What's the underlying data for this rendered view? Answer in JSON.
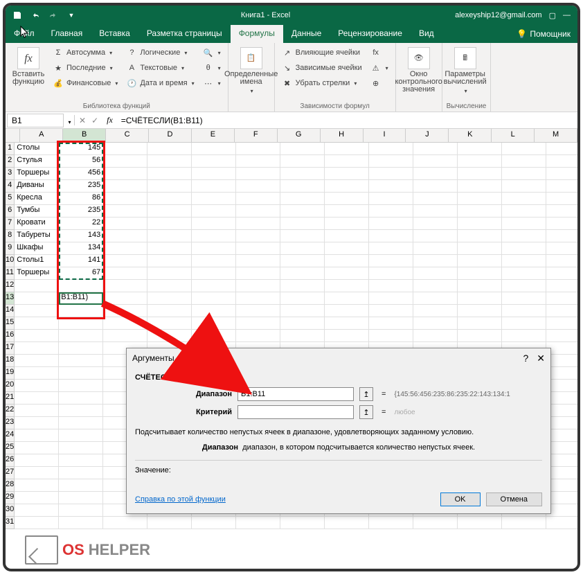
{
  "title": {
    "doc": "Книга1",
    "app": "Excel",
    "user": "alexeyship12@gmail.com"
  },
  "tabs": {
    "file": "Файл",
    "home": "Главная",
    "insert": "Вставка",
    "layout": "Разметка страницы",
    "formulas": "Формулы",
    "data": "Данные",
    "review": "Рецензирование",
    "view": "Вид",
    "help": "Помощник"
  },
  "ribbon": {
    "insert_func": "Вставить функцию",
    "autosum": "Автосумма",
    "recent": "Последние",
    "financial": "Финансовые",
    "logical": "Логические",
    "text": "Текстовые",
    "datetime": "Дата и время",
    "lookup_icon": "",
    "math_icon": "",
    "more_icon": "",
    "defined_names": "Определенные имена",
    "trace_prec": "Влияющие ячейки",
    "trace_dep": "Зависимые ячейки",
    "remove_arrows": "Убрать стрелки",
    "watch_window": "Окно контрольного значения",
    "calc_options": "Параметры вычислений",
    "group_lib": "Библиотека функций",
    "group_deps": "Зависимости формул",
    "group_calc": "Вычисление"
  },
  "fbar": {
    "name": "B1",
    "formula": "=СЧЁТЕСЛИ(B1:B11)"
  },
  "cols": [
    "A",
    "B",
    "C",
    "D",
    "E",
    "F",
    "G",
    "H",
    "I",
    "J",
    "K",
    "L",
    "M"
  ],
  "data_rows": [
    {
      "a": "Столы",
      "b": "145"
    },
    {
      "a": "Стулья",
      "b": "56"
    },
    {
      "a": "Торшеры",
      "b": "456"
    },
    {
      "a": "Диваны",
      "b": "235"
    },
    {
      "a": "Кресла",
      "b": "86"
    },
    {
      "a": "Тумбы",
      "b": "235"
    },
    {
      "a": "Кровати",
      "b": "22"
    },
    {
      "a": "Табуреты",
      "b": "143"
    },
    {
      "a": "Шкафы",
      "b": "134"
    },
    {
      "a": "Столы1",
      "b": "141"
    },
    {
      "a": "Торшеры",
      "b": "67"
    }
  ],
  "cell13b": "B1:B11)",
  "dialog": {
    "title": "Аргументы функции",
    "func": "СЧЁТЕСЛИ",
    "range_label": "Диапазон",
    "range_value": "B1:B11",
    "range_preview": "{145:56:456:235:86:235:22:143:134:1",
    "criteria_label": "Критерий",
    "criteria_preview": "любое",
    "desc": "Подсчитывает количество непустых ячеек в диапазоне, удовлетворяющих заданному условию.",
    "param_name": "Диапазон",
    "param_desc": "диапазон, в котором подсчитывается количество непустых ячеек.",
    "result_label": "Значение:",
    "help_link": "Справка по этой функции",
    "ok": "OK",
    "cancel": "Отмена"
  },
  "logo": {
    "os": "OS",
    "helper": "HELPER"
  }
}
